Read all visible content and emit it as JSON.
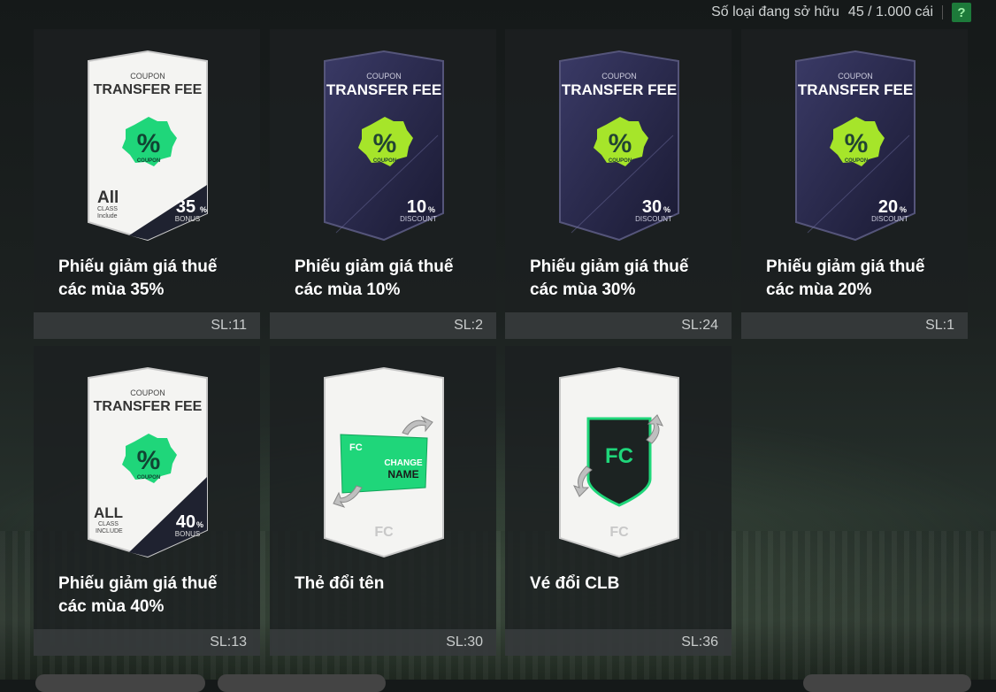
{
  "header": {
    "owned_label": "Số loại đang sở hữu",
    "owned_count": "45 / 1.000 cái",
    "help": "?"
  },
  "items": [
    {
      "name": "Phiếu giảm giá thuế các mùa 35%",
      "qty": "SL:11",
      "kind": "coupon",
      "theme": "white",
      "coupon_top": "COUPON",
      "coupon_title": "TRANSFER FEE",
      "badge_pct": "%",
      "badge_sub": "COUPON",
      "all_text": "All",
      "class_line1": "CLASS",
      "class_line2": "Include",
      "value": "35",
      "value_unit": "%",
      "value_label": "BONUS"
    },
    {
      "name": "Phiếu giảm giá thuế các mùa 10%",
      "qty": "SL:2",
      "kind": "coupon",
      "theme": "dark",
      "coupon_top": "COUPON",
      "coupon_title": "TRANSFER FEE",
      "badge_pct": "%",
      "badge_sub": "COUPON",
      "value": "10",
      "value_unit": "%",
      "value_label": "DISCOUNT"
    },
    {
      "name": "Phiếu giảm giá thuế các mùa 30%",
      "qty": "SL:24",
      "kind": "coupon",
      "theme": "dark",
      "coupon_top": "COUPON",
      "coupon_title": "TRANSFER FEE",
      "badge_pct": "%",
      "badge_sub": "COUPON",
      "value": "30",
      "value_unit": "%",
      "value_label": "DISCOUNT"
    },
    {
      "name": "Phiếu giảm giá thuế các mùa 20%",
      "qty": "SL:1",
      "kind": "coupon",
      "theme": "dark",
      "coupon_top": "COUPON",
      "coupon_title": "TRANSFER FEE",
      "badge_pct": "%",
      "badge_sub": "COUPON",
      "value": "20",
      "value_unit": "%",
      "value_label": "DISCOUNT"
    },
    {
      "name": "Phiếu giảm giá thuế các mùa 40%",
      "qty": "SL:13",
      "kind": "coupon",
      "theme": "white",
      "coupon_top": "COUPON",
      "coupon_title": "TRANSFER FEE",
      "badge_pct": "%",
      "badge_sub": "COUPON",
      "all_text": "ALL",
      "class_line1": "CLASS",
      "class_line2": "INCLUDE",
      "value": "40",
      "value_unit": "%",
      "value_label": "BONUS"
    },
    {
      "name": "Thẻ đổi tên",
      "qty": "SL:30",
      "kind": "rename",
      "card_text1": "CHANGE",
      "card_text2": "NAME"
    },
    {
      "name": "Vé đổi CLB",
      "qty": "SL:36",
      "kind": "club"
    }
  ],
  "colors": {
    "tile_bg": "#1c2021",
    "qty_bg": "#3c4042",
    "badge_green": "#1fd67a",
    "badge_lime": "#a6e52a",
    "dark_card": "#2a2a4a",
    "white_card": "#f3f3f1",
    "help_bg": "#1d7a3a"
  }
}
